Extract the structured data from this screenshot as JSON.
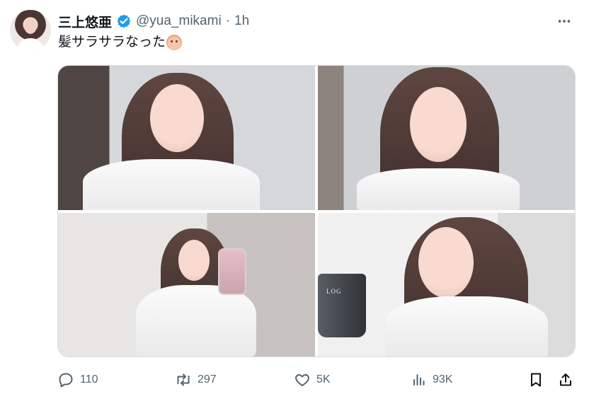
{
  "author": {
    "name": "三上悠亜",
    "handle": "@yua_mikami",
    "separator": "·",
    "time": "1h"
  },
  "tweet": {
    "text": "髪サラサラなった",
    "emoji": "baby-face-emoji"
  },
  "media": {
    "count": 4
  },
  "actions": {
    "replies": "110",
    "reposts": "297",
    "likes": "5K",
    "views": "93K"
  },
  "icons": {
    "verified": "verified-badge-icon",
    "more": "more-options-icon",
    "reply": "reply-icon",
    "repost": "repost-icon",
    "like": "heart-icon",
    "views": "analytics-icon",
    "bookmark": "bookmark-icon",
    "share": "share-icon"
  },
  "colors": {
    "text": "#0f1419",
    "muted": "#536471",
    "verified": "#1d9bf0",
    "border": "#d6dde2"
  }
}
